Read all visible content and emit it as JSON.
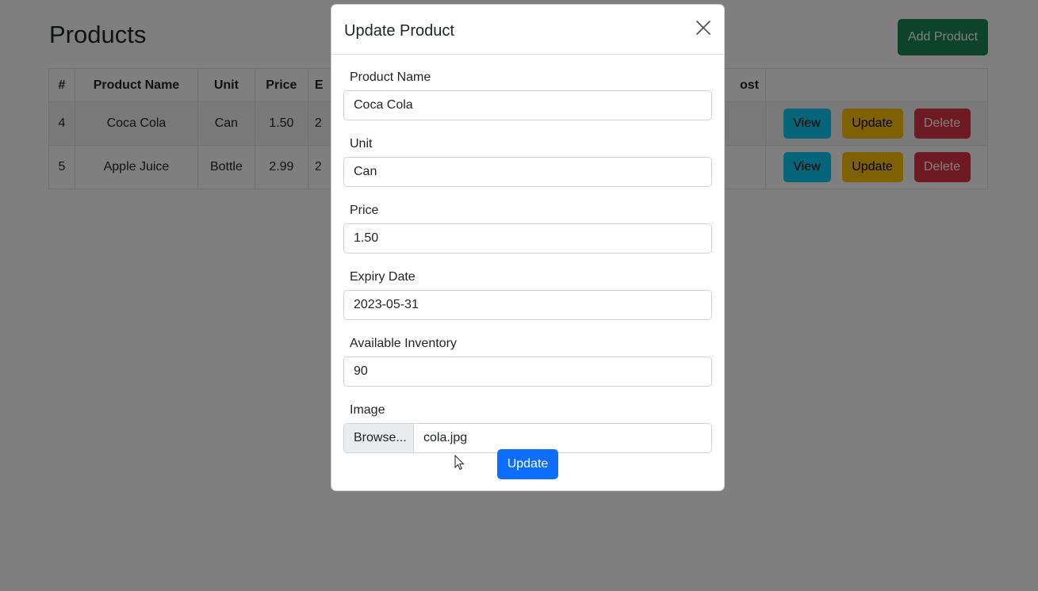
{
  "page": {
    "title": "Products",
    "add_button": "Add Product"
  },
  "table": {
    "headers": [
      "#",
      "Product Name",
      "Unit",
      "Price",
      "E",
      "ost",
      ""
    ],
    "rows": [
      {
        "num": "4",
        "name": "Coca Cola",
        "unit": "Can",
        "price": "1.50",
        "exp": "2"
      },
      {
        "num": "5",
        "name": "Apple Juice",
        "unit": "Bottle",
        "price": "2.99",
        "exp": "2"
      }
    ],
    "actions": {
      "view": "View",
      "update": "Update",
      "delete": "Delete"
    }
  },
  "modal": {
    "title": "Update Product",
    "fields": {
      "name": {
        "label": "Product Name",
        "value": "Coca Cola"
      },
      "unit": {
        "label": "Unit",
        "value": "Can"
      },
      "price": {
        "label": "Price",
        "value": "1.50"
      },
      "expiry": {
        "label": "Expiry Date",
        "value": "2023-05-31"
      },
      "inventory": {
        "label": "Available Inventory",
        "value": "90"
      },
      "image": {
        "label": "Image",
        "browse": "Browse...",
        "file": "cola.jpg"
      }
    },
    "submit": "Update"
  },
  "colors": {
    "success": "#198754",
    "info": "#0dcaf0",
    "warning": "#ffc107",
    "danger": "#dc3545",
    "primary": "#0d6efd"
  }
}
